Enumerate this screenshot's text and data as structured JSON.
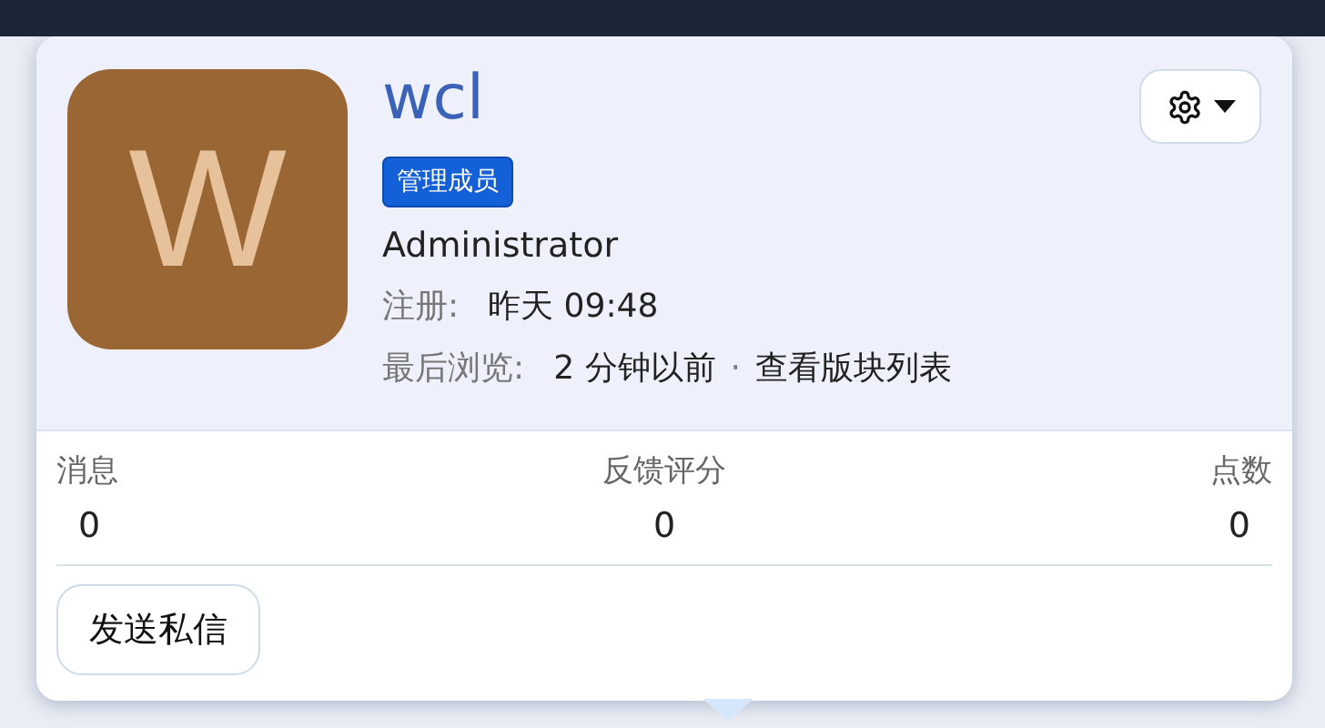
{
  "profile": {
    "avatar_letter": "W",
    "name": "wcl",
    "badge": "管理成员",
    "title": "Administrator",
    "details": [
      {
        "label": "注册:",
        "value": "昨天 09:48"
      },
      {
        "label": "最后浏览:",
        "value": "2 分钟以前",
        "separator": "·",
        "link": "查看版块列表"
      }
    ]
  },
  "stats": [
    {
      "label": "消息",
      "value": "0"
    },
    {
      "label": "反馈评分",
      "value": "0"
    },
    {
      "label": "点数",
      "value": "0"
    }
  ],
  "buttons": [
    "发送私信"
  ]
}
